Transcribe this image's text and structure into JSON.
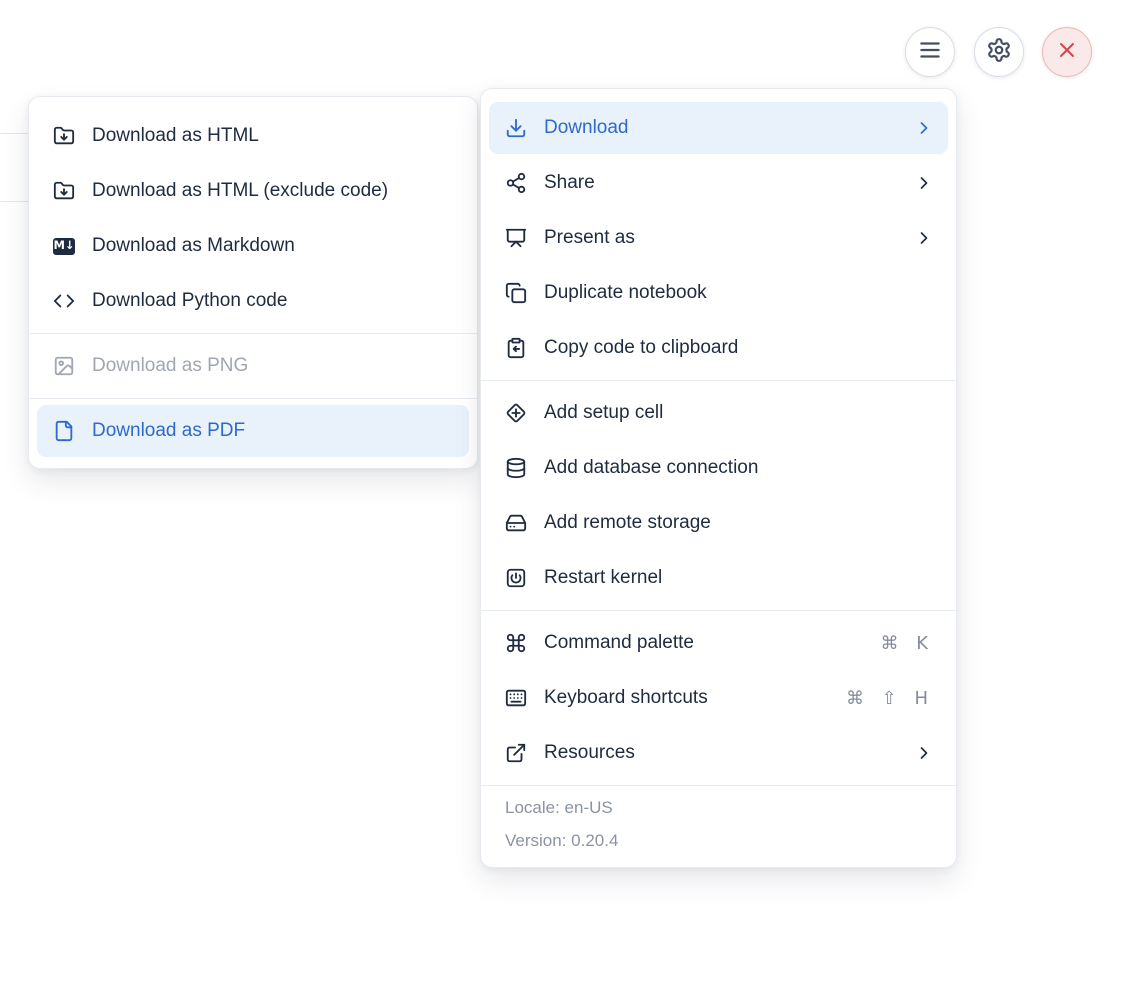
{
  "topbar": {
    "buttons": [
      {
        "name": "menu",
        "icon": "hamburger-icon"
      },
      {
        "name": "settings",
        "icon": "gear-icon"
      },
      {
        "name": "close",
        "icon": "close-x-icon"
      }
    ]
  },
  "download_submenu": {
    "items": [
      {
        "label": "Download as HTML",
        "icon": "folder-down-icon",
        "state": "normal"
      },
      {
        "label": "Download as HTML (exclude code)",
        "icon": "folder-down-icon",
        "state": "normal"
      },
      {
        "label": "Download as Markdown",
        "icon": "markdown-icon",
        "icon_text": "M↓",
        "state": "normal"
      },
      {
        "label": "Download Python code",
        "icon": "code-icon",
        "state": "normal"
      },
      {
        "label": "Download as PNG",
        "icon": "image-icon",
        "state": "disabled"
      },
      {
        "label": "Download as PDF",
        "icon": "file-icon",
        "state": "highlighted"
      }
    ]
  },
  "main_menu": {
    "items": [
      {
        "label": "Download",
        "icon": "download-icon",
        "state": "highlighted",
        "submenu": true
      },
      {
        "label": "Share",
        "icon": "share-icon",
        "submenu": true
      },
      {
        "label": "Present as",
        "icon": "presentation-icon",
        "submenu": true
      },
      {
        "label": "Duplicate notebook",
        "icon": "copy-icon"
      },
      {
        "label": "Copy code to clipboard",
        "icon": "clipboard-arrow-icon"
      },
      {
        "label": "Add setup cell",
        "icon": "diamond-plus-icon"
      },
      {
        "label": "Add database connection",
        "icon": "database-icon"
      },
      {
        "label": "Add remote storage",
        "icon": "hard-drive-icon"
      },
      {
        "label": "Restart kernel",
        "icon": "square-power-icon"
      },
      {
        "label": "Command palette",
        "icon": "command-icon",
        "shortcut": "⌘ K"
      },
      {
        "label": "Keyboard shortcuts",
        "icon": "keyboard-icon",
        "shortcut": "⌘ ⇧ H"
      },
      {
        "label": "Resources",
        "icon": "external-link-icon",
        "submenu": true
      }
    ],
    "footer": {
      "locale": "Locale: en-US",
      "version": "Version: 0.20.4"
    }
  },
  "colors": {
    "accent_blue": "#2e6ac7",
    "highlight_bg": "#e9f1fb",
    "text_dark": "#1f2b3e",
    "text_muted": "#8b93a2",
    "disabled_text": "#a0a7b1",
    "danger_red": "#d64747",
    "danger_bg": "#f9e9e9"
  }
}
